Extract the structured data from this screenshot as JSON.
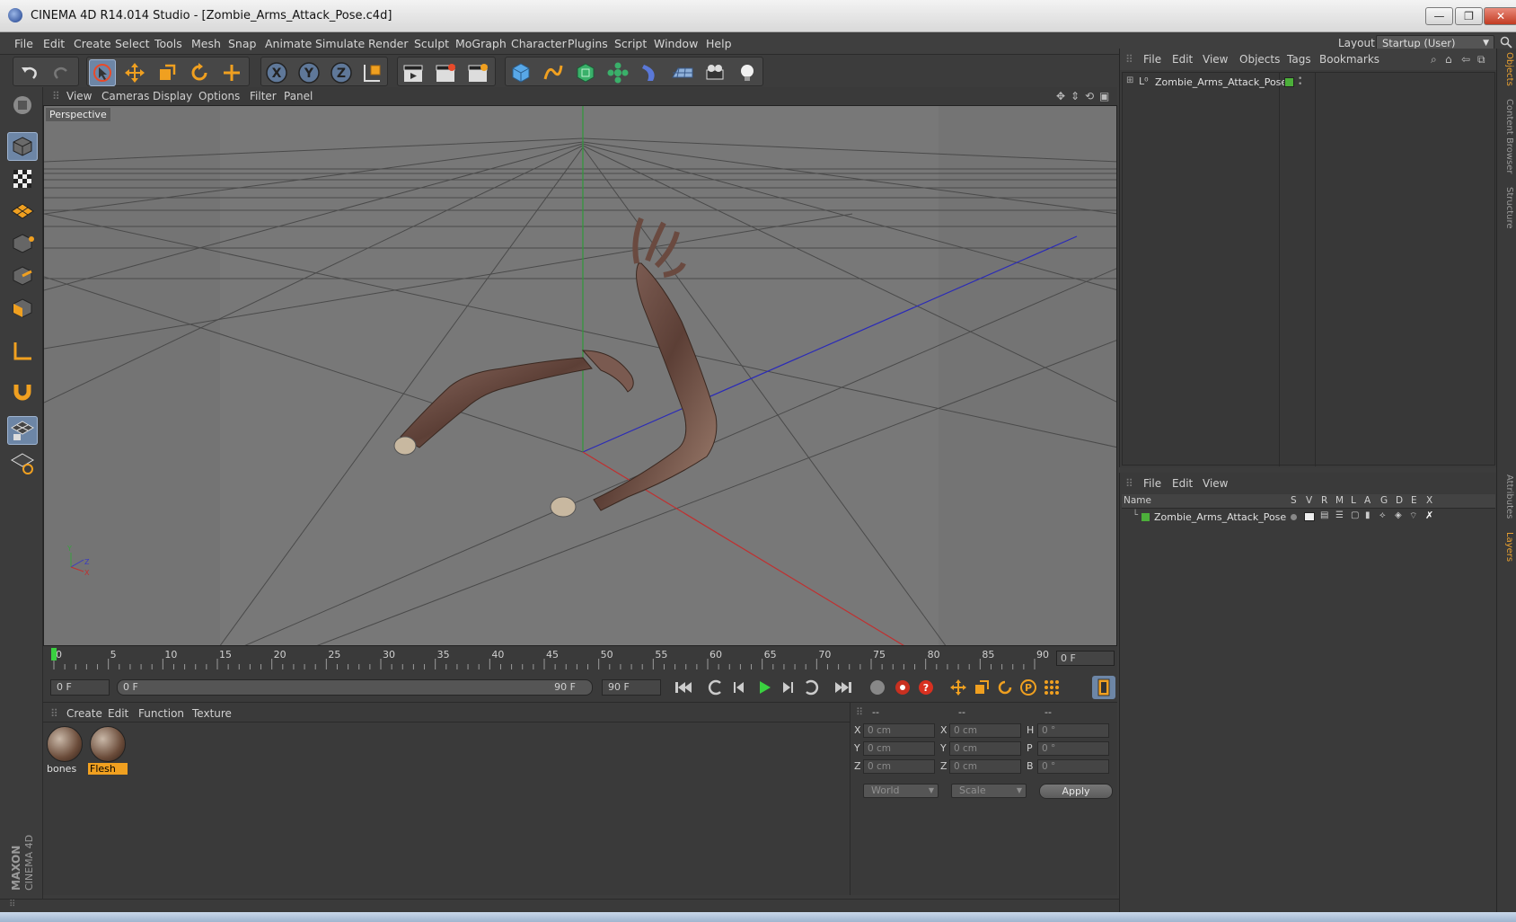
{
  "window": {
    "title": "CINEMA 4D R14.014 Studio - [Zombie_Arms_Attack_Pose.c4d]"
  },
  "menubar": {
    "items": [
      "File",
      "Edit",
      "Create",
      "Select",
      "Tools",
      "Mesh",
      "Snap",
      "Animate",
      "Simulate",
      "Render",
      "Sculpt",
      "MoGraph",
      "Character",
      "Plugins",
      "Script",
      "Window",
      "Help"
    ],
    "layout_label": "Layout:",
    "layout_value": "Startup (User)"
  },
  "viewport": {
    "menus": [
      "View",
      "Cameras",
      "Display",
      "Options",
      "Filter",
      "Panel"
    ],
    "label": "Perspective",
    "axis_labels": {
      "x": "X",
      "y": "Y",
      "z": "Z"
    }
  },
  "timeline": {
    "ticks": [
      "0",
      "5",
      "10",
      "15",
      "20",
      "25",
      "30",
      "35",
      "40",
      "45",
      "50",
      "55",
      "60",
      "65",
      "70",
      "75",
      "80",
      "85",
      "90"
    ],
    "current_frame": "0 F"
  },
  "playback": {
    "start_field": "0 F",
    "range_start": "0 F",
    "range_end": "90 F",
    "end_field": "90 F"
  },
  "materials": {
    "menus": [
      "Create",
      "Edit",
      "Function",
      "Texture"
    ],
    "items": [
      {
        "label": "bones",
        "selected": false
      },
      {
        "label": "Flesh",
        "selected": true
      }
    ]
  },
  "coordinates": {
    "headers": [
      "--",
      "--",
      "--"
    ],
    "rows": [
      {
        "l1": "X",
        "v1": "0 cm",
        "l2": "X",
        "v2": "0 cm",
        "l3": "H",
        "v3": "0 °"
      },
      {
        "l1": "Y",
        "v1": "0 cm",
        "l2": "Y",
        "v2": "0 cm",
        "l3": "P",
        "v3": "0 °"
      },
      {
        "l1": "Z",
        "v1": "0 cm",
        "l2": "Z",
        "v2": "0 cm",
        "l3": "B",
        "v3": "0 °"
      }
    ],
    "mode": "World",
    "size_mode": "Scale",
    "apply": "Apply"
  },
  "objects": {
    "menus": [
      "File",
      "Edit",
      "View",
      "Objects",
      "Tags",
      "Bookmarks"
    ],
    "items": [
      {
        "name": "Zombie_Arms_Attack_Pose"
      }
    ]
  },
  "layers": {
    "menus": [
      "File",
      "Edit",
      "View"
    ],
    "columns": [
      "Name",
      "S",
      "V",
      "R",
      "M",
      "L",
      "A",
      "G",
      "D",
      "E",
      "X"
    ],
    "items": [
      {
        "name": "Zombie_Arms_Attack_Pose"
      }
    ]
  },
  "side_tabs": [
    "Objects",
    "Content Browser",
    "Structure",
    "Attributes",
    "Layers"
  ],
  "brand": {
    "maxon": "MAXON",
    "product": "CINEMA 4D"
  },
  "colors": {
    "accent": "#f0a020",
    "active_tool": "#6d86a6",
    "layer_green": "#4caf3a"
  }
}
